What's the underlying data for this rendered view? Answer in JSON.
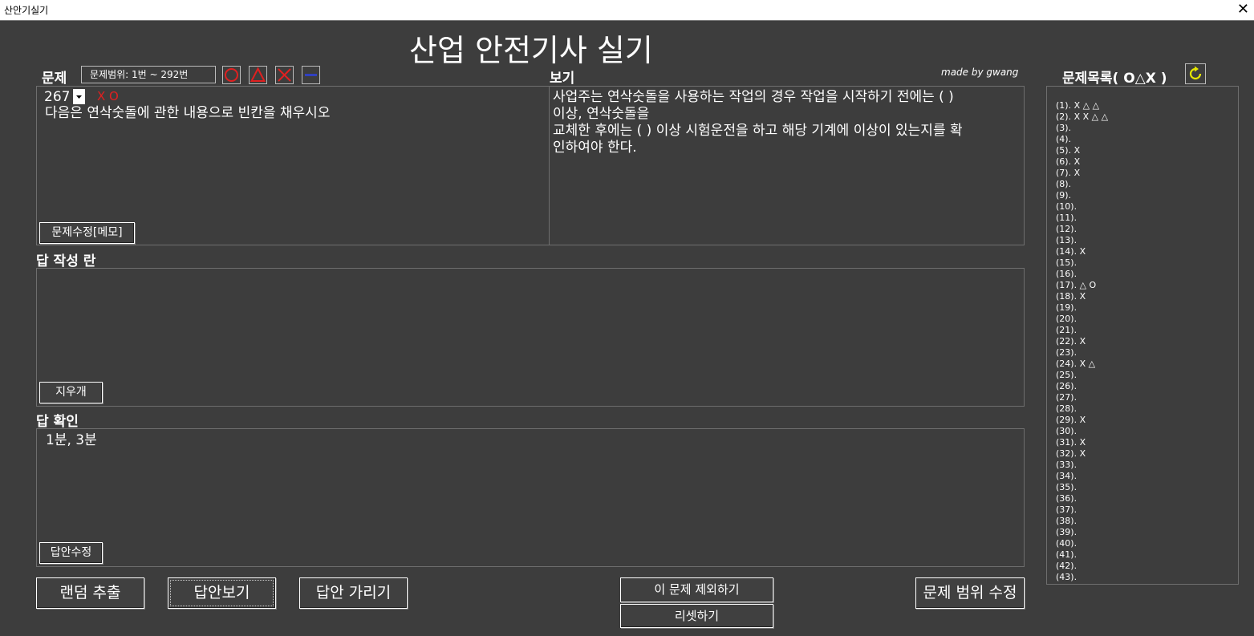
{
  "window": {
    "title": "산안기실기",
    "close_glyph": "✕"
  },
  "app_title": "산업 안전기사 실기",
  "question": {
    "label": "문제",
    "range": "문제범위: 1번 ~ 292번",
    "number": "267",
    "marks": "X O",
    "text": "다음은 연삭숫돌에 관한 내용으로 빈칸을 채우시오",
    "edit_button": "문제수정[메모]"
  },
  "mark_buttons": {
    "circle": "circle-icon",
    "triangle": "triangle-icon",
    "x": "x-icon",
    "dash": "dash-icon"
  },
  "view": {
    "label": "보기",
    "credit": "made by gwang",
    "lines": [
      "사업주는 연삭숫돌을 사용하는 작업의 경우 작업을 시작하기 전에는 (  )",
      "이상, 연삭숫돌을",
      "교체한 후에는 (  ) 이상 시험운전을 하고 해당 기계에 이상이 있는지를 확",
      "인하여야 한다."
    ]
  },
  "answer_write": {
    "label": "답 작성 란",
    "value": "",
    "eraser_button": "지우개"
  },
  "answer_check": {
    "label": "답 확인",
    "value": "1분, 3분",
    "edit_button": "답안수정"
  },
  "bottom": {
    "random": "랜덤 추출",
    "show_answer": "답안보기",
    "hide_answer": "답안 가리기",
    "exclude": "이 문제 제외하기",
    "reset": "리셋하기",
    "edit_range": "문제 범위 수정"
  },
  "list": {
    "title": "문제목록( O△X )",
    "items": [
      "(1). X △ △",
      "(2). X X △ △",
      "(3).",
      "(4).",
      "(5). X",
      "(6). X",
      "(7). X",
      "(8).",
      "(9).",
      "(10).",
      "(11).",
      "(12).",
      "(13).",
      "(14). X",
      "(15).",
      "(16).",
      "(17). △ O",
      "(18). X",
      "(19).",
      "(20).",
      "(21).",
      "(22). X",
      "(23).",
      "(24). X △",
      "(25).",
      "(26).",
      "(27).",
      "(28).",
      "(29). X",
      "(30).",
      "(31). X",
      "(32). X",
      "(33).",
      "(34).",
      "(35).",
      "(36).",
      "(37).",
      "(38).",
      "(39).",
      "(40).",
      "(41).",
      "(42).",
      "(43)."
    ]
  },
  "colors": {
    "background": "#3d3d3d",
    "mark_red": "#e02020",
    "refresh_yellow": "#e6e600",
    "dash_blue": "#3040c0"
  }
}
